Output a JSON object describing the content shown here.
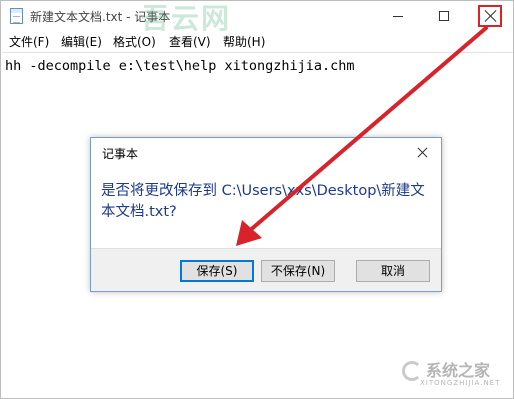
{
  "window": {
    "title": "新建文本文档.txt - 记事本",
    "icon": "notepad-icon",
    "watermark": "吾云网",
    "controls": {
      "minimize_icon": "minimize-icon",
      "maximize_icon": "maximize-icon",
      "close_icon": "close-icon",
      "close_highlight_color": "#d9222a"
    }
  },
  "menubar": {
    "items": [
      {
        "label": "文件(F)"
      },
      {
        "label": "编辑(E)"
      },
      {
        "label": "格式(O)"
      },
      {
        "label": "查看(V)"
      },
      {
        "label": "帮助(H)"
      }
    ]
  },
  "editor": {
    "content": "hh -decompile e:\\test\\help xitongzhijia.chm"
  },
  "dialog": {
    "title": "记事本",
    "message": "是否将更改保存到 C:\\Users\\xxs\\Desktop\\新建文本文档.txt?",
    "message_color": "#1e3a8c",
    "buttons": {
      "save": "保存(S)",
      "dont_save": "不保存(N)",
      "cancel": "取消"
    }
  },
  "annotation": {
    "arrow_color": "#d9222a"
  },
  "watermark_bottom": {
    "text": "系统之家",
    "sub": "XITONGZHIJIA.NET"
  },
  "colors": {
    "accent": "#0078d7",
    "dialog_border": "#7a9cc7"
  }
}
